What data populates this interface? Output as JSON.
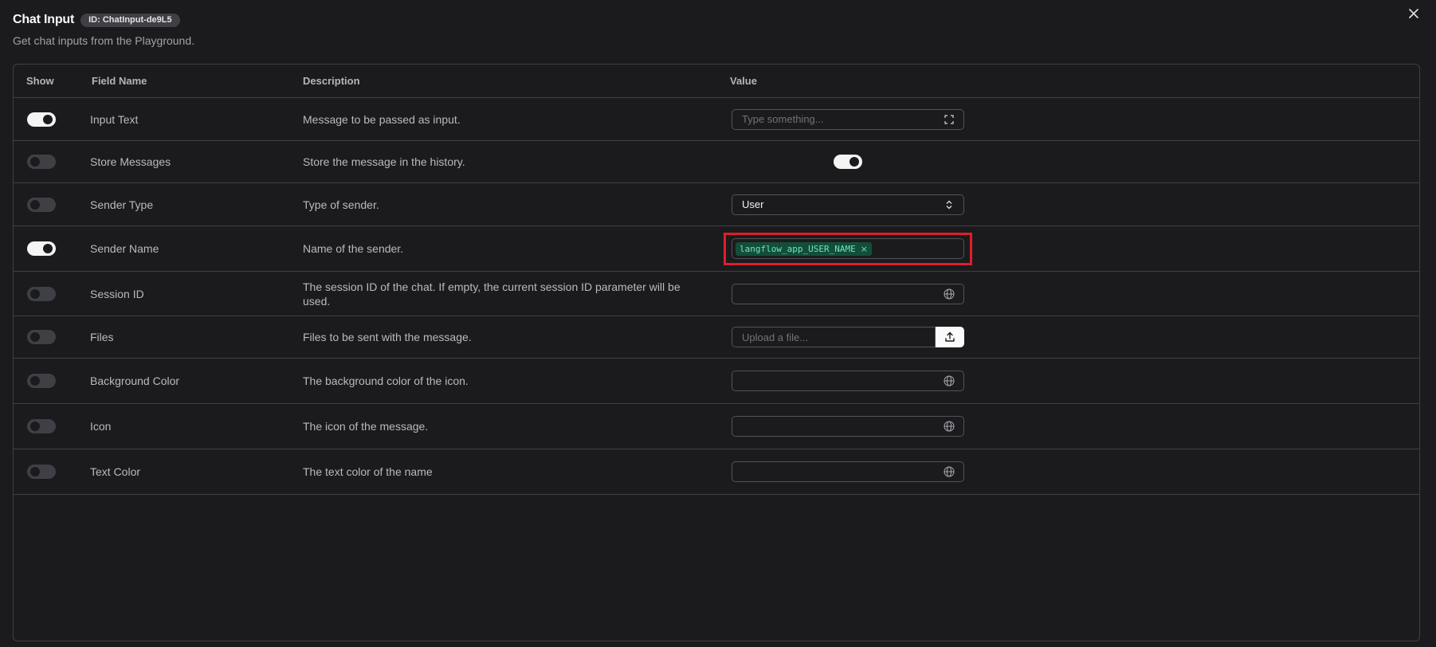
{
  "header": {
    "title": "Chat Input",
    "id_badge": "ID: ChatInput-de9L5",
    "subtitle": "Get chat inputs from the Playground."
  },
  "columns": {
    "show": "Show",
    "field_name": "Field Name",
    "description": "Description",
    "value": "Value"
  },
  "rows": [
    {
      "name": "Input Text",
      "description": "Message to be passed as input.",
      "show": true,
      "value_type": "text",
      "placeholder": "Type something...",
      "icon": "expand-icon"
    },
    {
      "name": "Store Messages",
      "description": "Store the message in the history.",
      "show": false,
      "value_type": "toggle",
      "value": true
    },
    {
      "name": "Sender Type",
      "description": "Type of sender.",
      "show": false,
      "value_type": "select",
      "value": "User",
      "icon": "chevron-up-down-icon"
    },
    {
      "name": "Sender Name",
      "description": "Name of the sender.",
      "show": true,
      "value_type": "chip",
      "value": "langflow_app_USER_NAME",
      "chip_close": "×",
      "highlight_color": "#e11d2a"
    },
    {
      "name": "Session ID",
      "description": "The session ID of the chat. If empty, the current session ID parameter will be used.",
      "show": false,
      "value_type": "global",
      "icon": "globe-icon"
    },
    {
      "name": "Files",
      "description": "Files to be sent with the message.",
      "show": false,
      "value_type": "upload",
      "placeholder": "Upload a file...",
      "icon": "upload-icon"
    },
    {
      "name": "Background Color",
      "description": "The background color of the icon.",
      "show": false,
      "value_type": "global",
      "icon": "globe-icon"
    },
    {
      "name": "Icon",
      "description": "The icon of the message.",
      "show": false,
      "value_type": "global",
      "icon": "globe-icon"
    },
    {
      "name": "Text Color",
      "description": "The text color of the name",
      "show": false,
      "value_type": "global",
      "icon": "globe-icon"
    }
  ],
  "colors": {
    "background": "#1b1b1d",
    "border": "#3f3f46",
    "chip_bg": "#134e3a",
    "chip_text": "#6ee7b7",
    "highlight": "#e11d2a"
  }
}
